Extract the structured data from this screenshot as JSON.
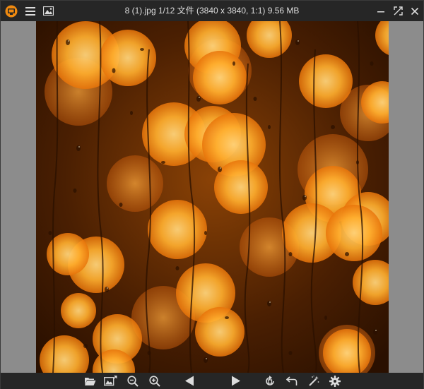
{
  "window": {
    "title": "8 (1).jpg 1/12 文件 (3840 x 3840, 1:1) 9.56 MB",
    "accent": "#f08a10"
  },
  "titlebar": {
    "left_icons": [
      "app-logo-icon",
      "menu-icon",
      "image-icon"
    ],
    "right_icons": [
      "minimize-icon",
      "fullscreen-icon",
      "close-icon"
    ]
  },
  "toolbar": {
    "icons": [
      "open-folder-icon",
      "open-image-icon",
      "zoom-out-icon",
      "zoom-in-icon",
      "previous-icon",
      "next-icon",
      "rotate-icon",
      "undo-icon",
      "magic-wand-icon",
      "settings-icon"
    ]
  },
  "photo": {
    "subject": "",
    "colors": {
      "bokeh_core": "#ffc24a",
      "bokeh_edge": "#f07d0a",
      "background": "#3a1a02"
    }
  }
}
